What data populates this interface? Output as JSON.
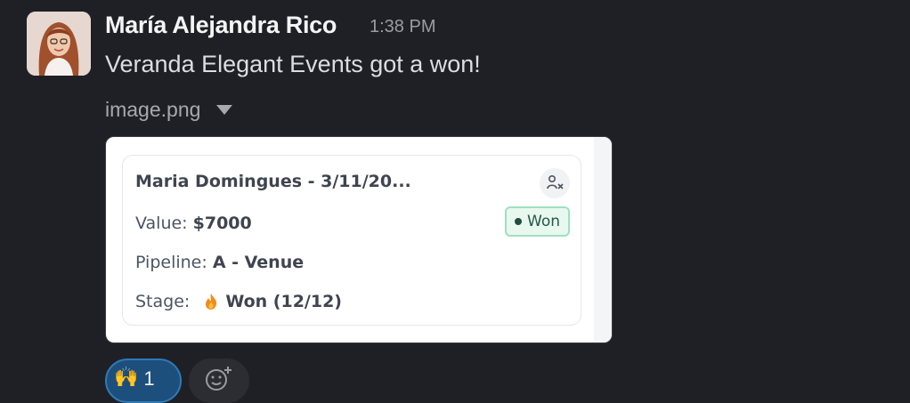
{
  "message": {
    "sender": "María Alejandra Rico",
    "time": "1:38 PM",
    "text": "Veranda Elegant Events got a won!",
    "attachment": {
      "filename": "image.png"
    }
  },
  "deal_card": {
    "title": "Maria Domingues - 3/11/20...",
    "status": "Won",
    "value_label": "Value:",
    "value": "$7000",
    "pipeline_label": "Pipeline:",
    "pipeline": "A - Venue",
    "stage_label": "Stage:",
    "stage": "Won (12/12)",
    "status_color": "#9ee0c1"
  },
  "reactions": [
    {
      "emoji": "🙌",
      "count": "1"
    }
  ],
  "colors": {
    "background": "#1f2026",
    "reaction_bg": "#1c4f7c",
    "reaction_border": "#2f7ab8"
  }
}
